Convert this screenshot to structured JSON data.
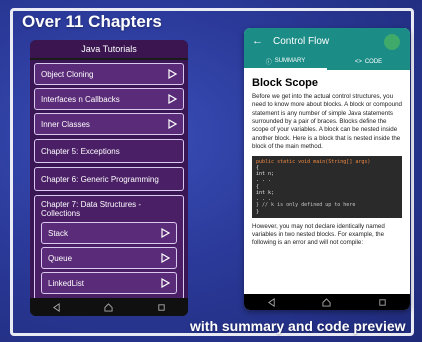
{
  "banner": {
    "headline": "Over 11 Chapters",
    "footline": "with summary and code preview"
  },
  "left_phone": {
    "title": "Java Tutorials",
    "items": [
      {
        "label": "Object Cloning"
      },
      {
        "label": "Interfaces n Callbacks"
      },
      {
        "label": "Inner Classes"
      }
    ],
    "chapters": [
      {
        "label": "Chapter 5: Exceptions"
      },
      {
        "label": "Chapter 6: Generic Programming"
      }
    ],
    "group": {
      "title": "Chapter 7: Data Structures - Collections",
      "items": [
        {
          "label": "Stack"
        },
        {
          "label": "Queue"
        },
        {
          "label": "LinkedList"
        }
      ]
    }
  },
  "right_phone": {
    "toolbar_title": "Control Flow",
    "tabs": [
      {
        "label": "SUMMARY"
      },
      {
        "label": "CODE"
      }
    ],
    "heading": "Block Scope",
    "para1": "Before we get into the actual control structures, you need to know more about blocks. A block or compound statement is any number of simple Java statements surrounded by a pair of braces. Blocks define the scope of your variables. A block can be nested inside another block. Here is a block that is nested inside the block of the main method.",
    "code_lines": [
      "public static void main(String[] args)",
      "{",
      "int n;",
      ". . .",
      "{",
      "int k;",
      ". . .",
      "} // k is only defined up to here",
      "}"
    ],
    "para2": "However, you may not declare identically named variables in two nested blocks. For example, the following is an error and will not compile:"
  },
  "colors": {
    "background": "#2b3a9a",
    "list_bg": "#3b1654",
    "accent": "#1b8c86"
  },
  "icons": {
    "arrow": "play-arrow-icon",
    "back": "arrow-left-icon",
    "share": "share-icon",
    "summary": "info-icon",
    "code": "code-icon",
    "nav_back": "triangle-back-icon",
    "nav_home": "home-icon",
    "nav_recent": "square-recent-icon"
  }
}
